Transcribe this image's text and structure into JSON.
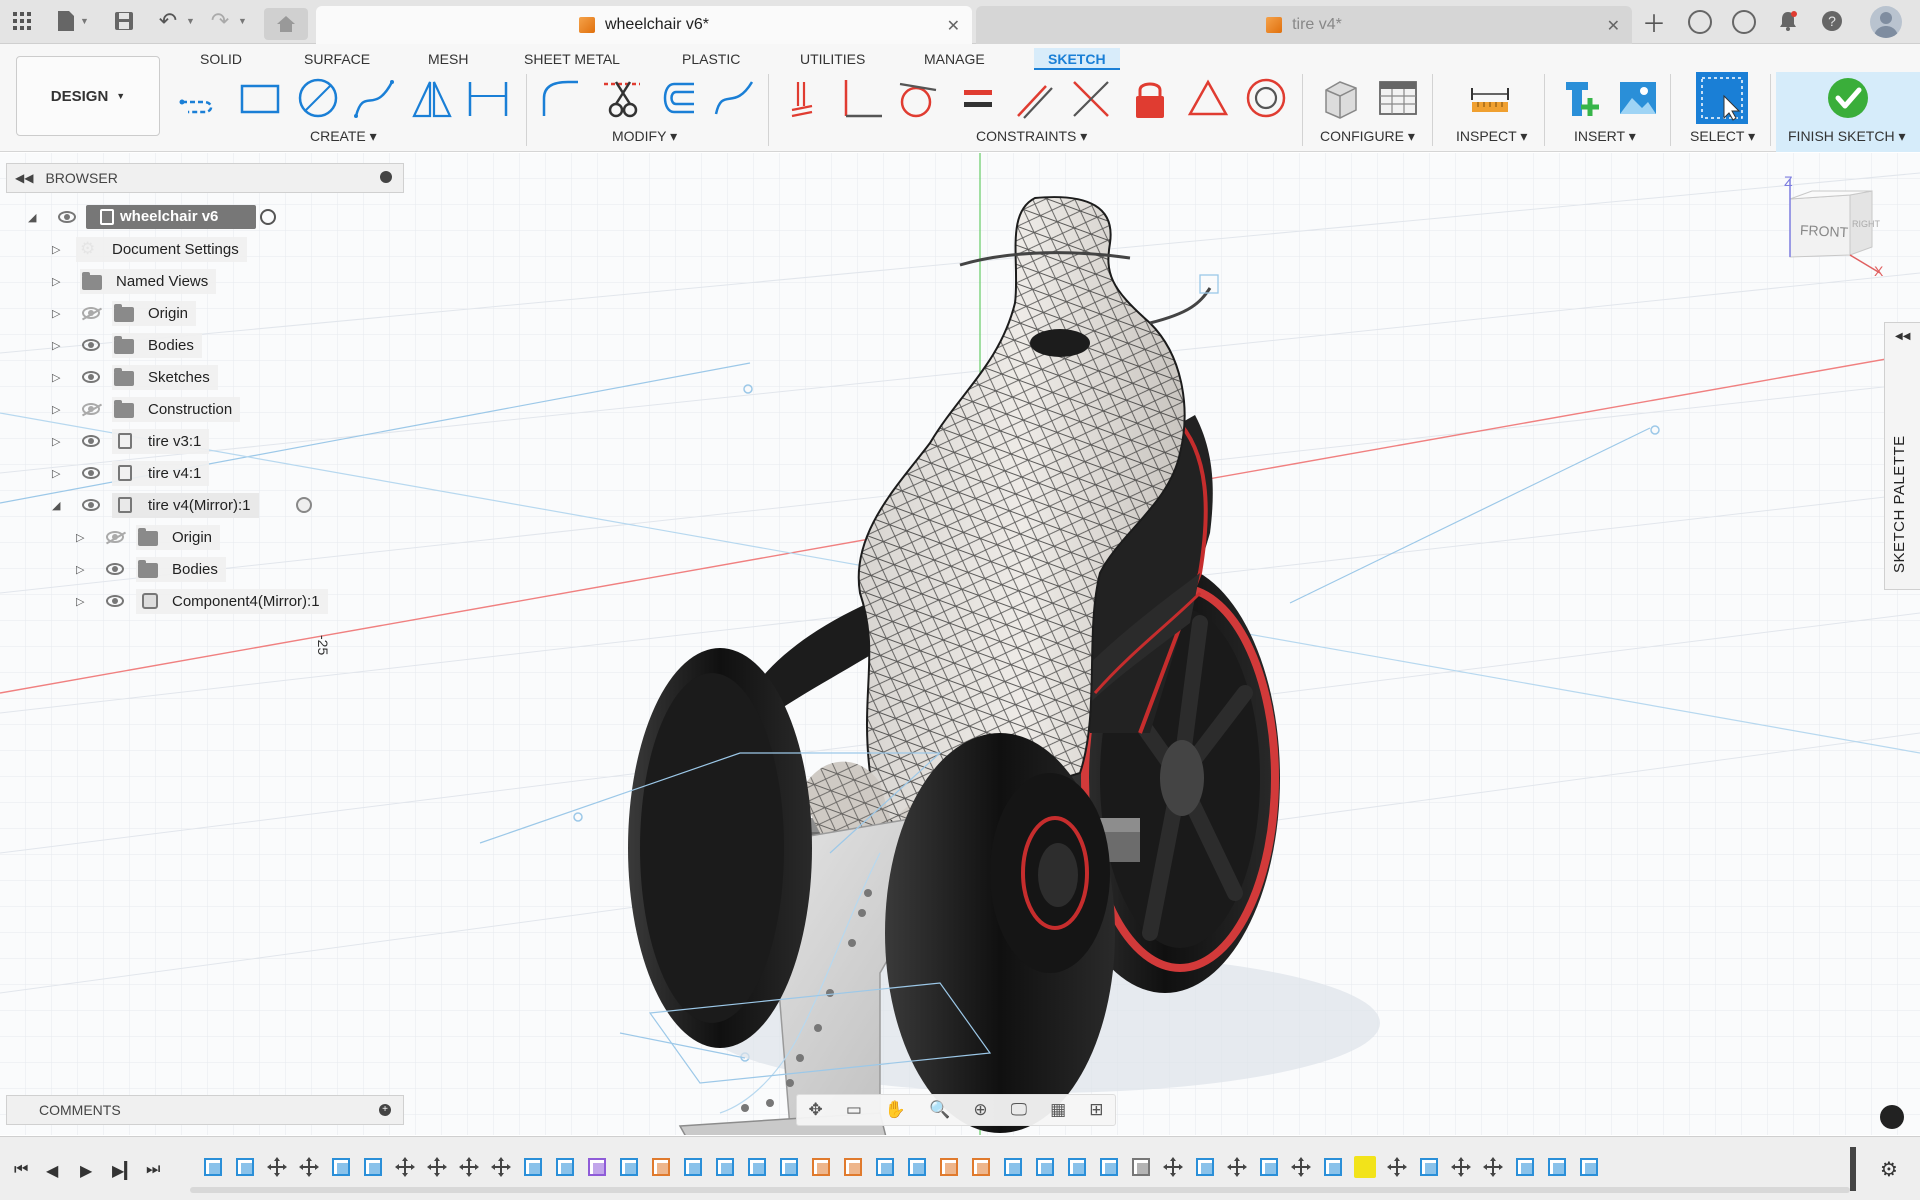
{
  "titlebar": {
    "active_tab": "wheelchair v6*",
    "inactive_tab": "tire v4*"
  },
  "ribbon": {
    "workspace": "DESIGN",
    "tabs": [
      "SOLID",
      "SURFACE",
      "MESH",
      "SHEET METAL",
      "PLASTIC",
      "UTILITIES",
      "MANAGE",
      "SKETCH"
    ],
    "groups": {
      "create": "CREATE",
      "modify": "MODIFY",
      "constraints": "CONSTRAINTS",
      "configure": "CONFIGURE",
      "inspect": "INSPECT",
      "insert": "INSERT",
      "select": "SELECT",
      "finish": "FINISH SKETCH"
    },
    "accent": "#1a7fd6",
    "finish_color": "#3aae3a"
  },
  "browser": {
    "title": "BROWSER",
    "root": "wheelchair v6",
    "items": [
      {
        "label": "Document Settings"
      },
      {
        "label": "Named Views"
      },
      {
        "label": "Origin"
      },
      {
        "label": "Bodies"
      },
      {
        "label": "Sketches"
      },
      {
        "label": "Construction"
      },
      {
        "label": "tire v3:1"
      },
      {
        "label": "tire v4:1"
      },
      {
        "label": "tire v4(Mirror):1"
      },
      {
        "label": "Origin"
      },
      {
        "label": "Bodies"
      },
      {
        "label": "Component4(Mirror):1"
      }
    ]
  },
  "viewport": {
    "dimension_label": "-25",
    "viewcube": {
      "face": "FRONT",
      "right": "RIGHT",
      "z": "Z",
      "x": "X"
    }
  },
  "comments": {
    "title": "COMMENTS"
  },
  "palette": {
    "title": "SKETCH PALETTE"
  }
}
